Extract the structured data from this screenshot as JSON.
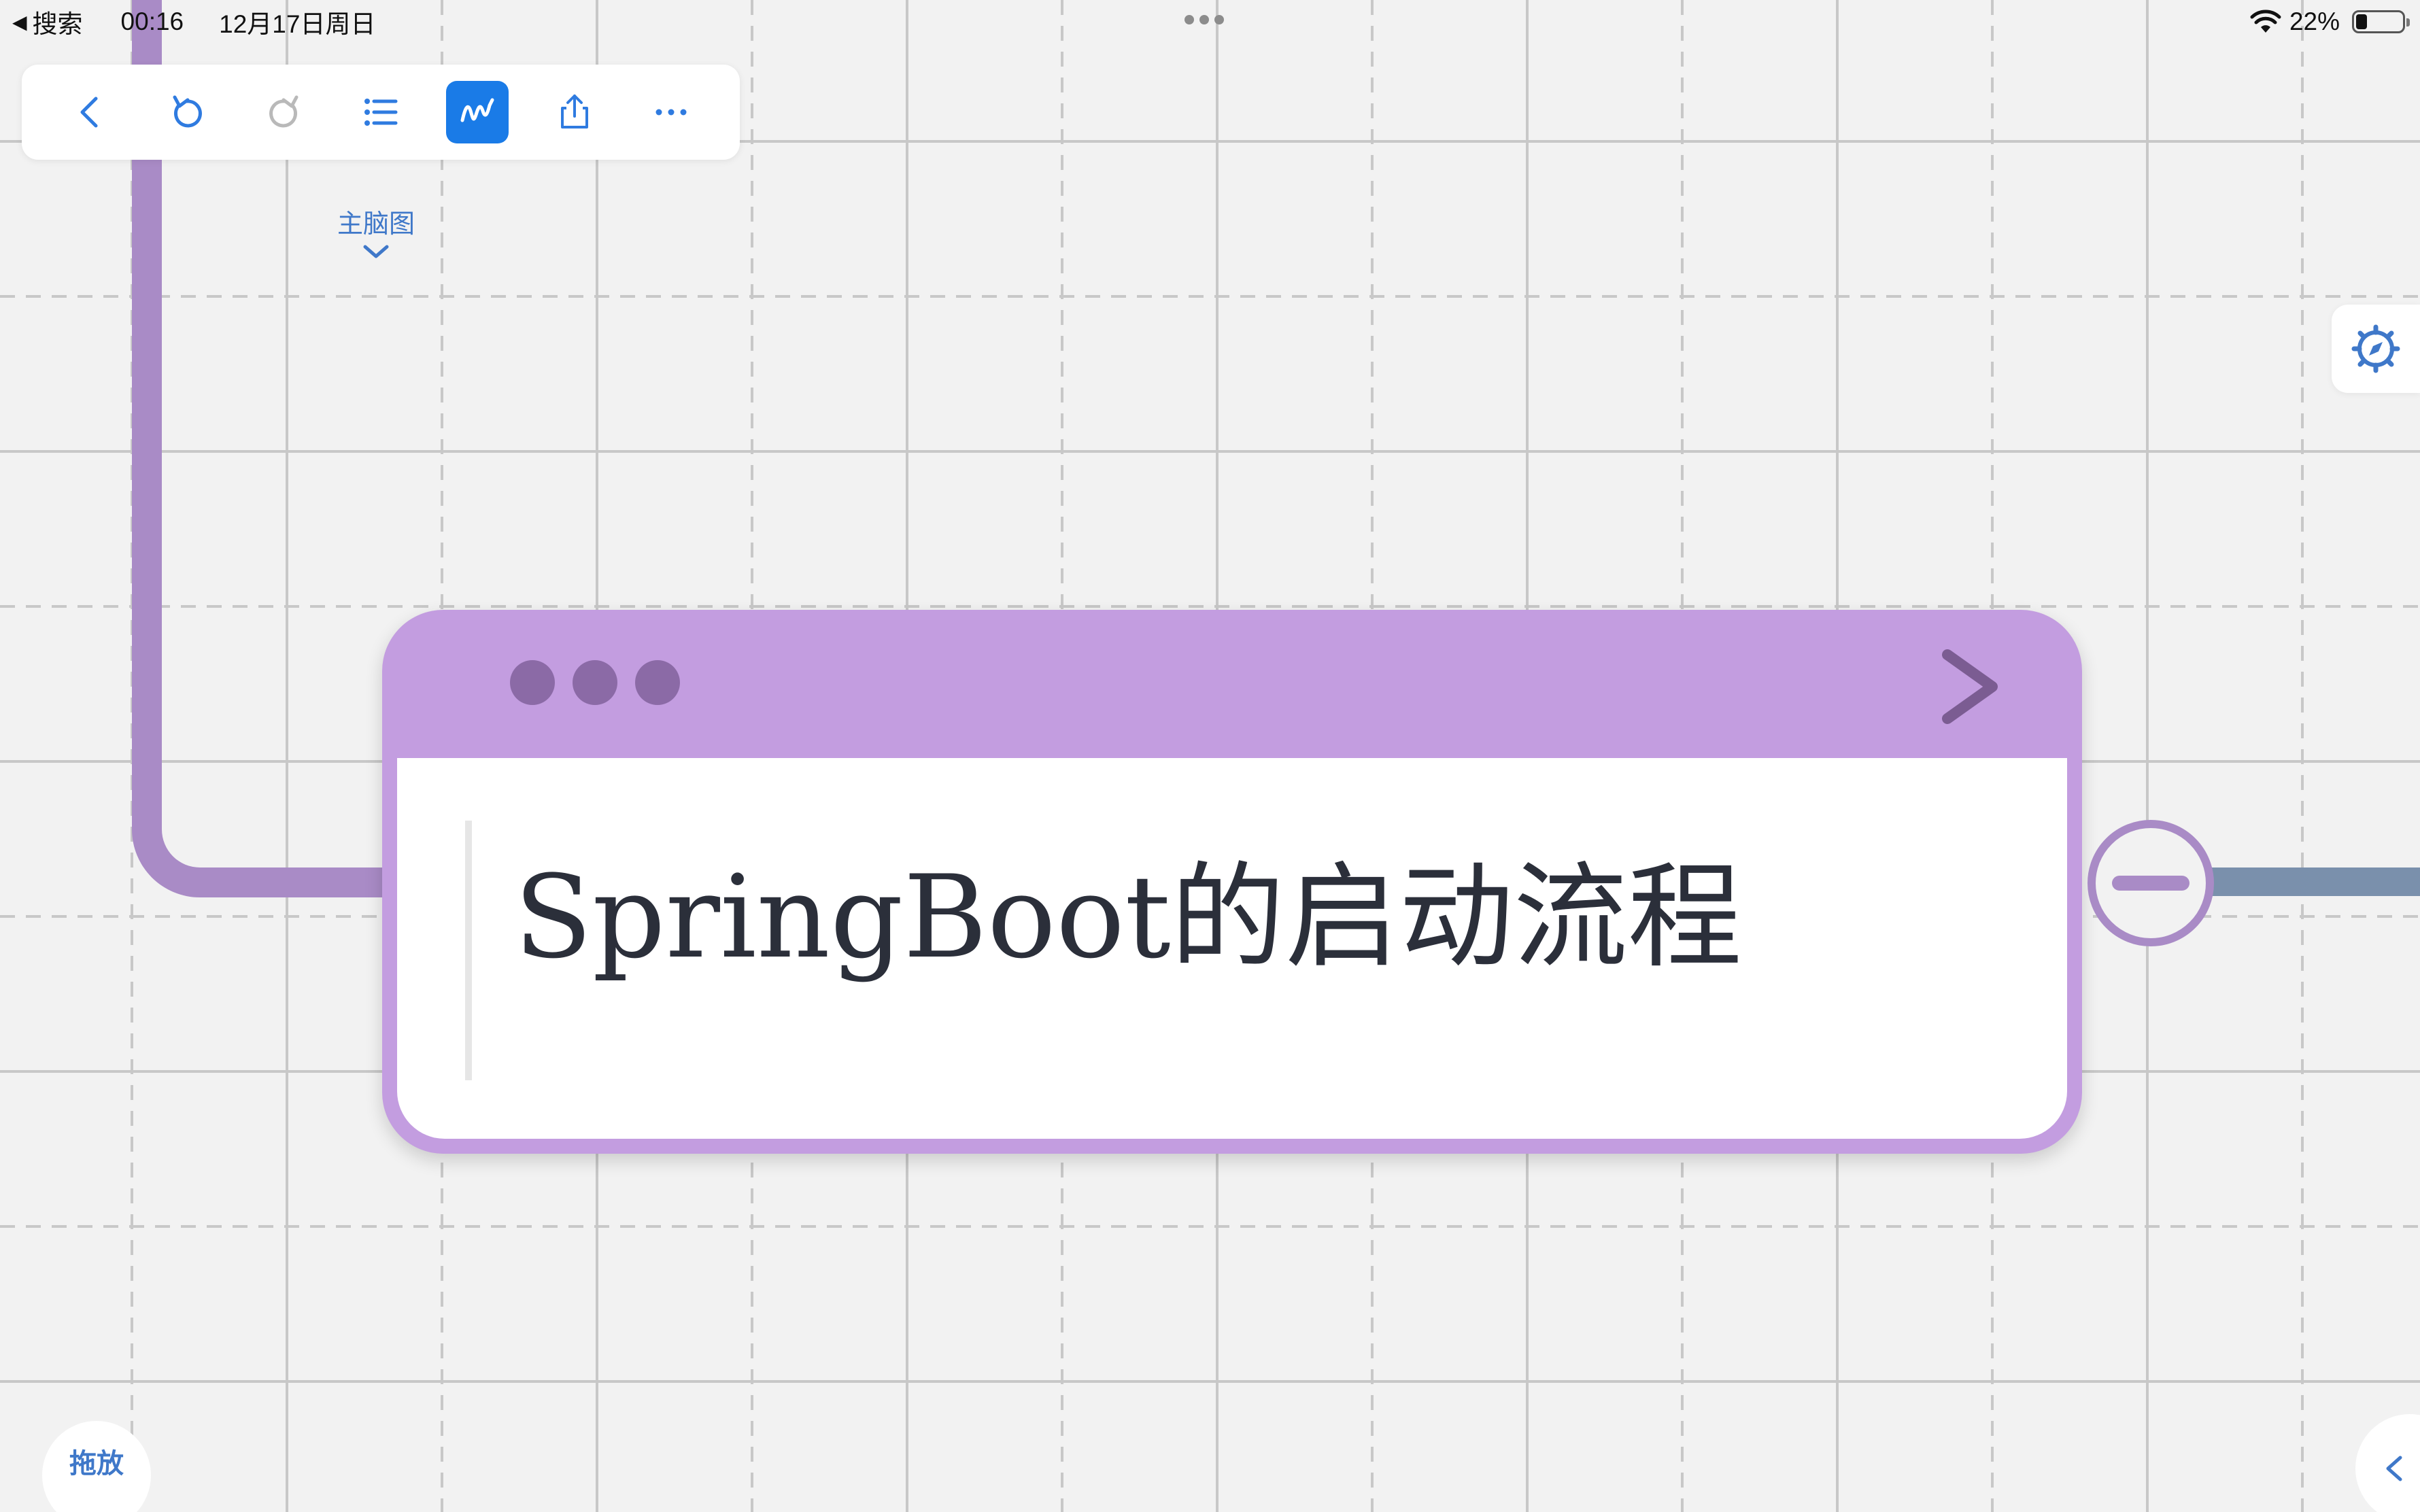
{
  "status_bar": {
    "back_label": "搜索",
    "time": "00:16",
    "date": "12月17日周日",
    "battery_percent": "22%",
    "battery_level": 0.22
  },
  "toolbar": {
    "items": [
      {
        "name": "back",
        "icon": "chevron-left-icon"
      },
      {
        "name": "undo",
        "icon": "undo-icon"
      },
      {
        "name": "redo",
        "icon": "redo-icon"
      },
      {
        "name": "outline",
        "icon": "list-icon"
      },
      {
        "name": "draw",
        "icon": "scribble-icon",
        "active": true
      },
      {
        "name": "share",
        "icon": "share-icon"
      },
      {
        "name": "more",
        "icon": "ellipsis-icon"
      }
    ]
  },
  "map_selector": {
    "label": "主脑图"
  },
  "node": {
    "title": "SpringBoot的启动流程",
    "header_color": "#c39de0",
    "connector_color": "#a98bc6",
    "child_connector_color": "#7a90ac"
  },
  "bottom": {
    "drag_label": "拖放"
  },
  "colors": {
    "accent": "#1a7be7",
    "label_blue": "#3f78c9",
    "canvas": "#f2f2f2"
  }
}
